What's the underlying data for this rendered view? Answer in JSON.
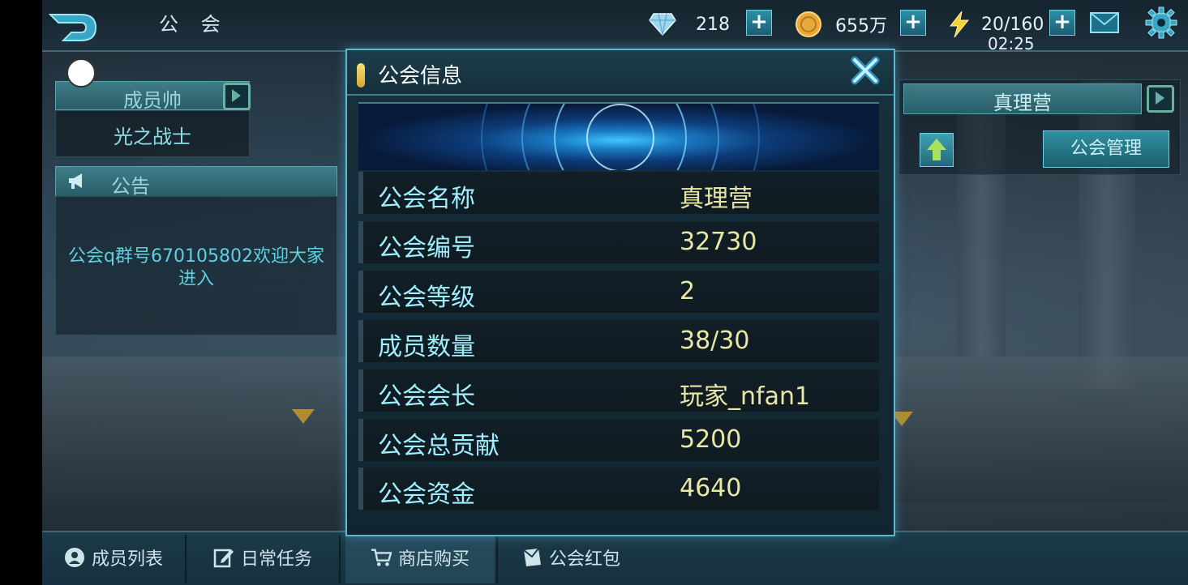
{
  "topbar": {
    "screen_title": "公 会",
    "diamonds": "218",
    "gold": "655万",
    "energy": "20/160",
    "time": "02:25"
  },
  "left_panel": {
    "member_role": "成员帅",
    "member_name": "光之战士",
    "notice_title": "公告",
    "notice_text": "公会q群号670105802欢迎大家进入"
  },
  "right_panel": {
    "guild_name": "真理营",
    "manage_label": "公会管理"
  },
  "modal": {
    "title": "公会信息",
    "rows": [
      {
        "label": "公会名称",
        "value": "真理营"
      },
      {
        "label": "公会编号",
        "value": "32730"
      },
      {
        "label": "公会等级",
        "value": "2"
      },
      {
        "label": "成员数量",
        "value": "38/30"
      },
      {
        "label": "公会会长",
        "value": "玩家_nfan1"
      },
      {
        "label": "公会总贡献",
        "value": "5200"
      },
      {
        "label": "公会资金",
        "value": "4640"
      }
    ]
  },
  "bottom_nav": {
    "tabs": [
      {
        "label": "成员列表",
        "icon": "member-list-icon"
      },
      {
        "label": "日常任务",
        "icon": "daily-task-icon"
      },
      {
        "label": "商店购买",
        "icon": "shop-cart-icon"
      },
      {
        "label": "公会红包",
        "icon": "red-packet-icon"
      }
    ]
  },
  "colors": {
    "accent": "#5fb6cf",
    "label": "#9ff0ff",
    "value": "#e9e7a4"
  }
}
